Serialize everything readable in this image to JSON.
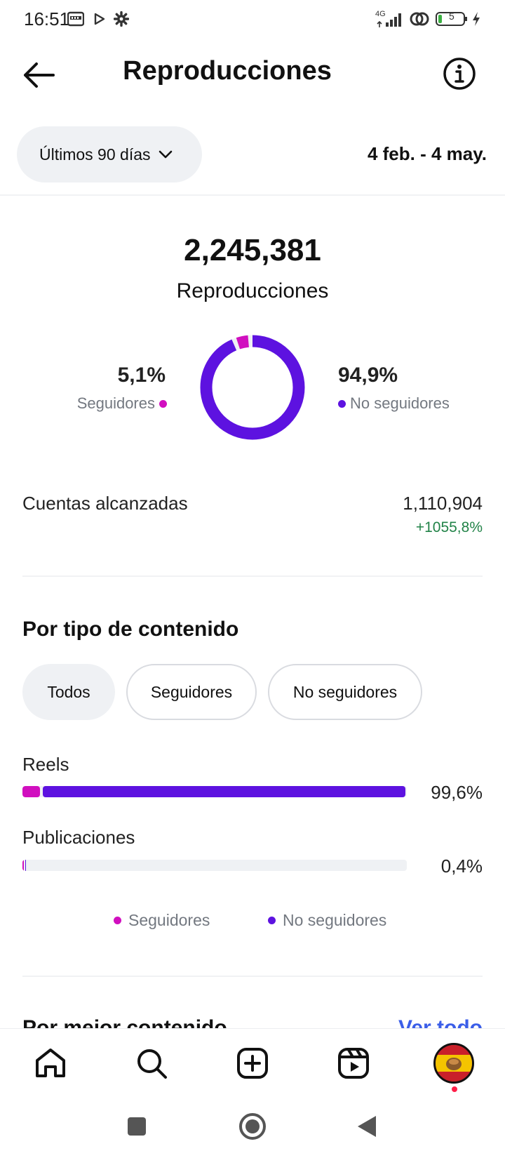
{
  "status_bar": {
    "time": "16:51",
    "network": "4G",
    "battery": "5",
    "icons": [
      "media-icon",
      "play-store-icon",
      "settings-icon",
      "signal-icon",
      "hotspot-icon",
      "battery-icon",
      "charging-icon"
    ]
  },
  "header": {
    "title": "Reproducciones",
    "back_icon": "back-arrow-icon",
    "info_icon": "info-icon"
  },
  "filter": {
    "period": "Últimos 90 días",
    "date_range": "4 feb. - 4 may."
  },
  "summary": {
    "total": "2,245,381",
    "label": "Reproducciones",
    "followers_pct": "5,1%",
    "followers_label": "Seguidores",
    "non_followers_pct": "94,9%",
    "non_followers_label": "No seguidores",
    "donut": {
      "followers_fraction": 0.051,
      "non_followers_fraction": 0.949
    }
  },
  "reach": {
    "label": "Cuentas alcanzadas",
    "value": "1,110,904",
    "delta": "+1055,8%"
  },
  "content_type": {
    "title": "Por tipo de contenido",
    "chips": [
      "Todos",
      "Seguidores",
      "No seguidores"
    ],
    "active_chip": "Todos",
    "rows": [
      {
        "label": "Reels",
        "pct": "99,6%",
        "total_fraction": 0.996,
        "followers_fraction": 0.046
      },
      {
        "label": "Publicaciones",
        "pct": "0,4%",
        "total_fraction": 0.004,
        "followers_fraction": 0.002
      }
    ],
    "legend": [
      "Seguidores",
      "No seguidores"
    ]
  },
  "best_content": {
    "title": "Por mejor contenido",
    "see_all": "Ver todo"
  },
  "colors": {
    "followers": "#d10fbf",
    "non_followers": "#5d12e0",
    "positive": "#228348",
    "link": "#3b5ee8"
  },
  "bottom_nav": [
    "home-icon",
    "search-icon",
    "create-icon",
    "reels-icon",
    "profile-avatar"
  ]
}
